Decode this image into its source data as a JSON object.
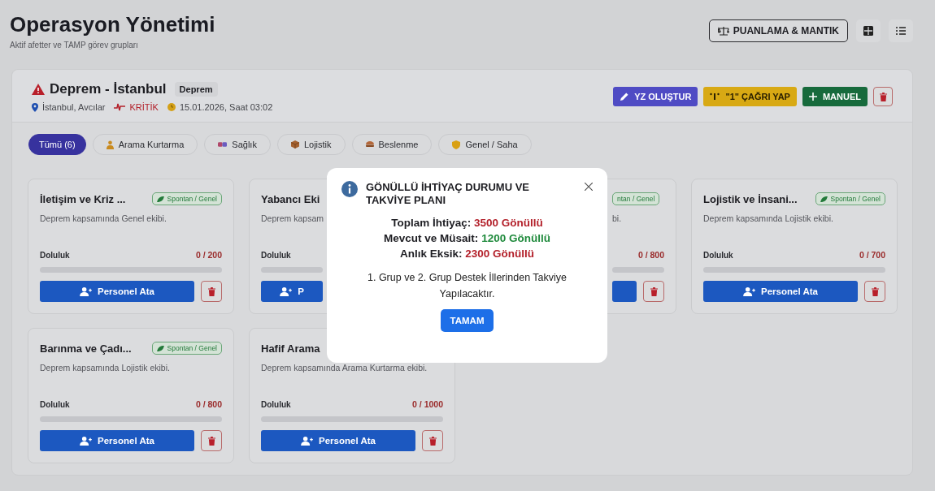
{
  "header": {
    "title": "Operasyon Yönetimi",
    "subtitle": "Aktif afetter ve TAMP görev grupları",
    "scoring_button": "PUANLAMA & MANTIK"
  },
  "disaster": {
    "title": "Deprem - İstanbul",
    "type_badge": "Deprem",
    "location": "İstanbul, Avcılar",
    "severity": "KRİTİK",
    "datetime": "15.01.2026, Saat 03:02",
    "actions": [
      {
        "kind": "ai",
        "label": "YZ OLUŞTUR"
      },
      {
        "kind": "call",
        "label": "\"1\" ÇAĞRI YAP"
      },
      {
        "kind": "manual",
        "label": "MANUEL"
      },
      {
        "kind": "delete"
      }
    ]
  },
  "filters": [
    {
      "kind": "all",
      "label": "Tümü (6)",
      "selected": true
    },
    {
      "kind": "person",
      "label": "Arama Kurtarma",
      "selected": false
    },
    {
      "kind": "medical",
      "label": "Sağlık",
      "selected": false
    },
    {
      "kind": "box",
      "label": "Lojistik",
      "selected": false
    },
    {
      "kind": "food",
      "label": "Beslenme",
      "selected": false
    },
    {
      "kind": "shield",
      "label": "Genel / Saha",
      "selected": false
    }
  ],
  "groups": [
    {
      "kind": "full",
      "title": "İletişim ve Kriz ...",
      "tag": "Spontan / Genel",
      "description": "Deprem kapsamında Genel ekibi.",
      "fill_label": "Doluluk",
      "count": "0 / 200",
      "button": "Personel Ata"
    },
    {
      "kind": "left_part",
      "title": "Yabancı Eki",
      "description": "Deprem kapsam",
      "fill_label": "Doluluk",
      "button": "P"
    },
    {
      "kind": "right_part",
      "tag": "ntan / Genel",
      "description": "bi.",
      "count": "0 / 800"
    },
    {
      "kind": "full",
      "title": "Lojistik ve İnsani...",
      "tag": "Spontan / Genel",
      "description": "Deprem kapsamında Lojistik ekibi.",
      "fill_label": "Doluluk",
      "count": "0 / 700",
      "button": "Personel Ata"
    },
    {
      "kind": "full",
      "title": "Barınma ve Çadı...",
      "tag": "Spontan / Genel",
      "description": "Deprem kapsamında Lojistik ekibi.",
      "fill_label": "Doluluk",
      "count": "0 / 800",
      "button": "Personel Ata"
    },
    {
      "kind": "full",
      "title": "Hafif Arama",
      "description": "Deprem kapsamında Arama Kurtarma ekibi.",
      "fill_label": "Doluluk",
      "count": "0 / 1000",
      "button": "Personel Ata"
    }
  ],
  "modal": {
    "title": "GÖNÜLLÜ İHTİYAÇ DURUMU VE TAKVİYE PLANI",
    "stats": [
      {
        "label": "Toplam İhtiyaç:",
        "value": "3500 Gönüllü",
        "color": "#b3202a"
      },
      {
        "label": "Mevcut ve Müsait:",
        "value": "1200 Gönüllü",
        "color": "#1f8a3c"
      },
      {
        "label": "Anlık Eksik:",
        "value": "2300 Gönüllü",
        "color": "#b3202a"
      }
    ],
    "note": "1. Grup ve 2. Grup Destek İllerinden Takviye Yapılacaktır.",
    "button": "TAMAM"
  }
}
